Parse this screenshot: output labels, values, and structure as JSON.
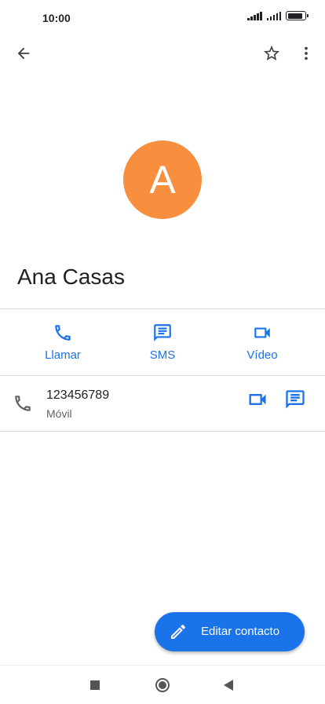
{
  "status_bar": {
    "time": "10:00",
    "battery_level": 0.9
  },
  "app_bar": {
    "back_icon": "arrow-back-icon",
    "star_icon": "star-outline-icon",
    "more_icon": "more-vert-icon"
  },
  "contact": {
    "initial": "A",
    "avatar_color": "#f78f3f",
    "name": "Ana Casas"
  },
  "actions": [
    {
      "label": "Llamar",
      "icon": "phone-icon"
    },
    {
      "label": "SMS",
      "icon": "message-icon"
    },
    {
      "label": "Vídeo",
      "icon": "videocam-icon"
    }
  ],
  "phone_entry": {
    "number": "123456789",
    "type": "Móvil"
  },
  "fab": {
    "label": "Editar contacto",
    "icon": "pencil-icon"
  },
  "colors": {
    "accent": "#1a73e8",
    "text_primary": "#202124",
    "text_secondary": "#5f6368"
  }
}
